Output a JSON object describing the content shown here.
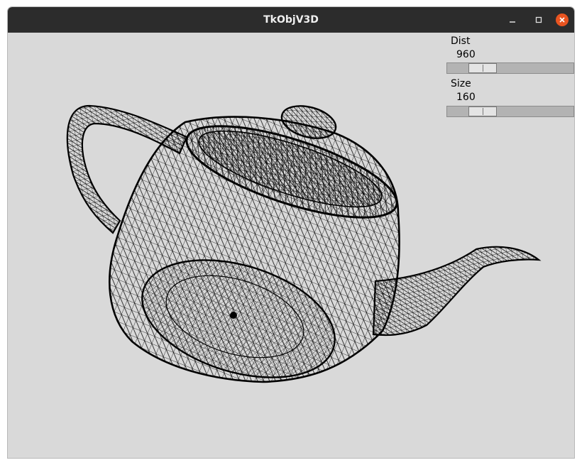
{
  "window": {
    "title": "TkObjV3D"
  },
  "titlebar_icons": {
    "minimize": "minimize-icon",
    "maximize": "maximize-icon",
    "close": "close-icon"
  },
  "controls": {
    "dist": {
      "label": "Dist",
      "value": "960",
      "level": 0.2
    },
    "size": {
      "label": "Size",
      "value": "160",
      "level": 0.2
    }
  },
  "viewport": {
    "model": "teapot",
    "render_mode": "wireframe",
    "line_color": "#000000",
    "background": "#d9d9d9"
  },
  "colors": {
    "titlebar": "#2c2c2c",
    "close_button": "#e95420",
    "window_bg": "#d9d9d9"
  }
}
